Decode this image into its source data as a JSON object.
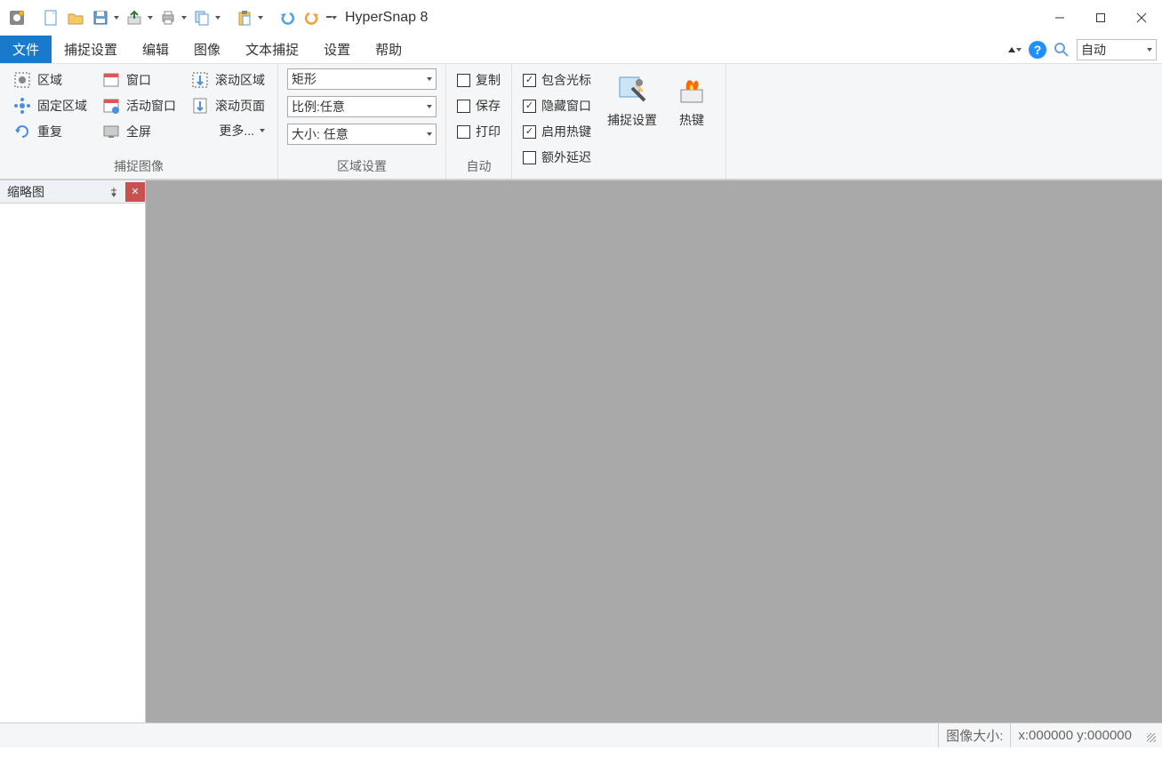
{
  "title": "HyperSnap 8",
  "menu": {
    "file": "文件",
    "capture_settings": "捕捉设置",
    "edit": "编辑",
    "image": "图像",
    "text_capture": "文本捕捉",
    "settings": "设置",
    "help": "帮助",
    "search_value": "自动"
  },
  "ribbon": {
    "group1": {
      "label": "捕捉图像",
      "region": "区域",
      "fixed_region": "固定区域",
      "repeat": "重复",
      "window": "窗口",
      "active_window": "活动窗口",
      "fullscreen": "全屏",
      "scroll_region": "滚动区域",
      "scroll_page": "滚动页面",
      "more": "更多..."
    },
    "group2": {
      "label": "区域设置",
      "shape": "矩形",
      "ratio": "比例:任意",
      "size": "大小: 任意"
    },
    "group3": {
      "label": "自动",
      "copy": "复制",
      "save": "保存",
      "print": "打印"
    },
    "group4": {
      "include_cursor": "包含光标",
      "hide_window": "隐藏窗口",
      "enable_hotkey": "启用热键",
      "extra_delay": "额外延迟"
    },
    "capture_settings_btn": "捕捉设置",
    "hotkey_btn": "热键"
  },
  "thumb_panel": {
    "title": "缩略图"
  },
  "status": {
    "image_size_label": "图像大小:",
    "coords": "x:000000 y:000000"
  }
}
